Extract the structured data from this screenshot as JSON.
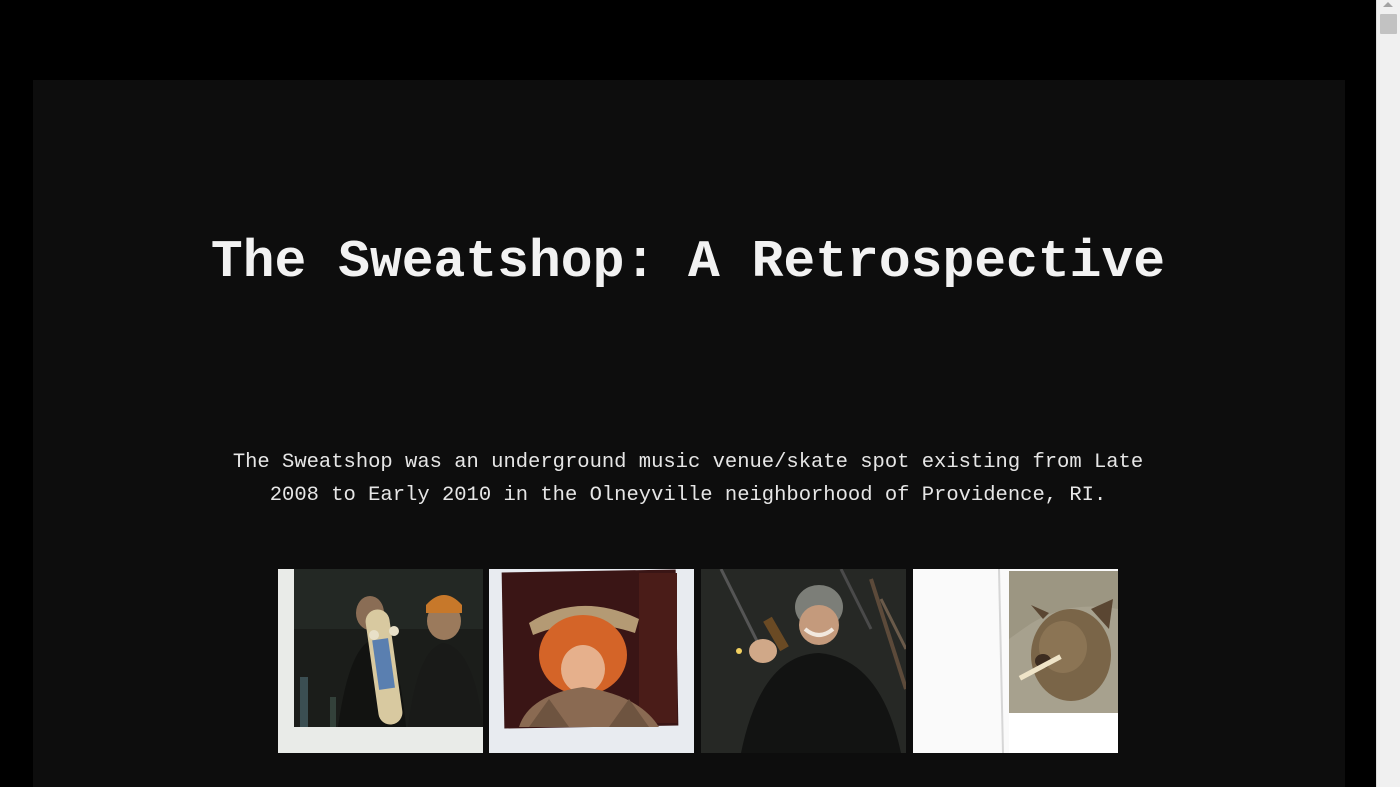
{
  "page": {
    "title": "The Sweatshop: A Retrospective",
    "intro": "The Sweatshop was an underground music venue/skate spot existing from Late 2008 to Early 2010 in the Olneyville neighborhood of Providence, RI."
  },
  "gallery": {
    "photos": [
      {
        "subject": "polaroid-two-men-with-skateboard"
      },
      {
        "subject": "polaroid-red-haired-person-in-hat"
      },
      {
        "subject": "polaroid-smiling-man-in-beanie"
      },
      {
        "subject": "polaroid-dog-with-stick"
      }
    ]
  },
  "colors": {
    "background": "#000000",
    "panel": "#0d0d0d",
    "text": "#f2f2f2"
  }
}
